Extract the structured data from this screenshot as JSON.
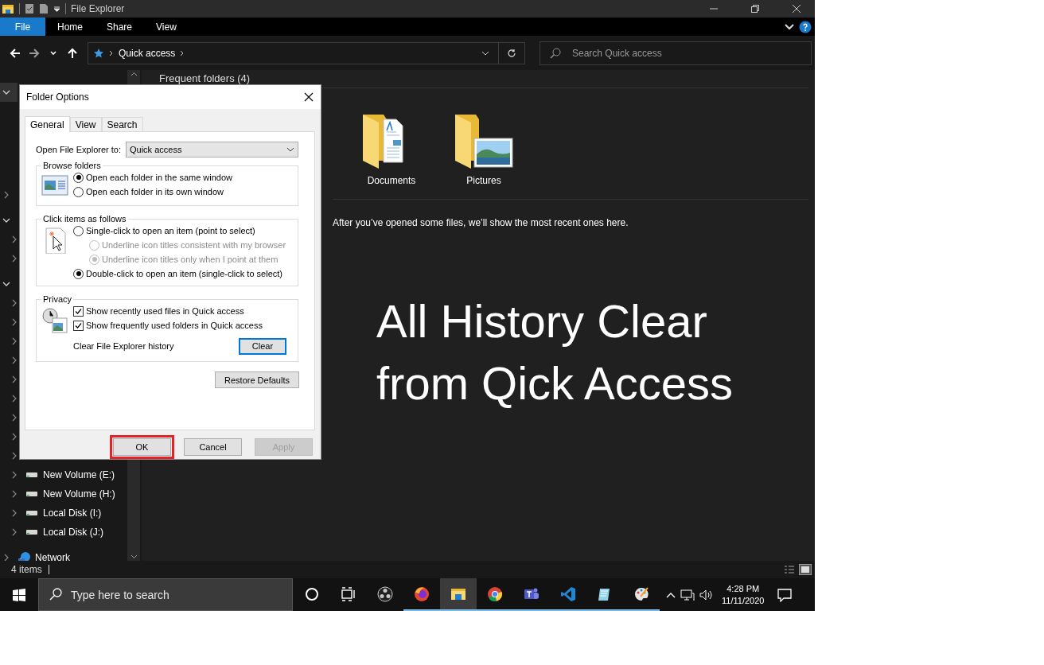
{
  "window": {
    "title": "File Explorer"
  },
  "ribbon": {
    "file_button": "File",
    "tabs": [
      {
        "label": "Home",
        "selected": false
      },
      {
        "label": "Share",
        "selected": false
      },
      {
        "label": "View",
        "selected": false
      }
    ]
  },
  "address_bar": {
    "path": [
      "Quick access"
    ]
  },
  "search": {
    "placeholder": "Search Quick access"
  },
  "navigation_pane": {
    "items": [
      {
        "expanded": true
      },
      {
        "expanded": false
      },
      {
        "expanded": true,
        "children": [
          {
            "expanded": false
          },
          {
            "expanded": false
          }
        ]
      },
      {
        "expanded": true,
        "children": [
          {
            "expanded": false
          },
          {
            "expanded": false
          },
          {
            "expanded": false
          },
          {
            "expanded": false
          },
          {
            "expanded": false
          },
          {
            "expanded": false
          },
          {
            "expanded": false
          },
          {
            "expanded": false
          },
          {
            "expanded": false
          },
          {
            "label": "New Volume (E:)",
            "kind": "drive",
            "expanded": false
          },
          {
            "label": "New Volume (H:)",
            "kind": "drive",
            "expanded": false
          },
          {
            "label": "Local Disk (I:)",
            "kind": "drive",
            "expanded": false
          },
          {
            "label": "Local Disk (J:)",
            "kind": "drive",
            "expanded": false
          }
        ]
      },
      {
        "label": "Network",
        "kind": "network",
        "expanded": false
      }
    ]
  },
  "content": {
    "section_title": "Frequent folders (4)",
    "folders": [
      {
        "name": "Documents",
        "kind": "documents"
      },
      {
        "name": "Pictures",
        "kind": "pictures"
      }
    ],
    "recent_message": "After you’ve opened some files, we’ll show the most recent ones here.",
    "overlay_caption": [
      "All History Clear",
      "from Qick Access"
    ]
  },
  "status_bar": {
    "item_count": "4 items"
  },
  "dialog": {
    "title": "Folder Options",
    "tabs": [
      {
        "label": "General",
        "selected": true
      },
      {
        "label": "View",
        "selected": false
      },
      {
        "label": "Search",
        "selected": false
      }
    ],
    "open_to": {
      "label": "Open File Explorer to:",
      "value": "Quick access"
    },
    "groups": [
      {
        "title": "Browse folders",
        "kind": "browse",
        "options": [
          {
            "kind": "radio",
            "label": "Open each folder in the same window",
            "selected": true,
            "disabled": false
          },
          {
            "kind": "radio",
            "label": "Open each folder in its own window",
            "selected": false,
            "disabled": false
          }
        ]
      },
      {
        "title": "Click items as follows",
        "kind": "click",
        "options": [
          {
            "kind": "radio",
            "label": "Single-click to open an item (point to select)",
            "selected": false,
            "disabled": false,
            "children": [
              {
                "kind": "radio",
                "label": "Underline icon titles consistent with my browser",
                "selected": false,
                "disabled": true
              },
              {
                "kind": "radio",
                "label": "Underline icon titles only when I point at them",
                "selected": true,
                "disabled": true
              }
            ]
          },
          {
            "kind": "radio",
            "label": "Double-click to open an item (single-click to select)",
            "selected": true,
            "disabled": false
          }
        ]
      },
      {
        "title": "Privacy",
        "kind": "privacy",
        "options": [
          {
            "kind": "checkbox",
            "label": "Show recently used files in Quick access",
            "checked": true
          },
          {
            "kind": "checkbox",
            "label": "Show frequently used folders in Quick access",
            "checked": true
          }
        ],
        "clear": {
          "label": "Clear File Explorer history",
          "button": "Clear",
          "focused": true
        }
      }
    ],
    "restore_button": "Restore Defaults",
    "buttons": [
      {
        "label": "OK",
        "disabled": false,
        "highlighted": true
      },
      {
        "label": "Cancel",
        "disabled": false,
        "highlighted": false
      },
      {
        "label": "Apply",
        "disabled": true,
        "highlighted": false
      }
    ]
  },
  "taskbar": {
    "search_placeholder": "Type here to search",
    "apps": [
      {
        "running": false,
        "selected": false
      },
      {
        "running": false,
        "selected": false
      },
      {
        "running": false,
        "selected": false
      },
      {
        "running": true,
        "selected": false
      },
      {
        "running": true,
        "selected": true
      },
      {
        "running": true,
        "selected": false
      },
      {
        "running": true,
        "selected": false
      },
      {
        "running": true,
        "selected": false
      },
      {
        "running": true,
        "selected": false
      },
      {
        "running": true,
        "selected": false
      }
    ],
    "time": "4:28 PM",
    "date": "11/11/2020"
  }
}
